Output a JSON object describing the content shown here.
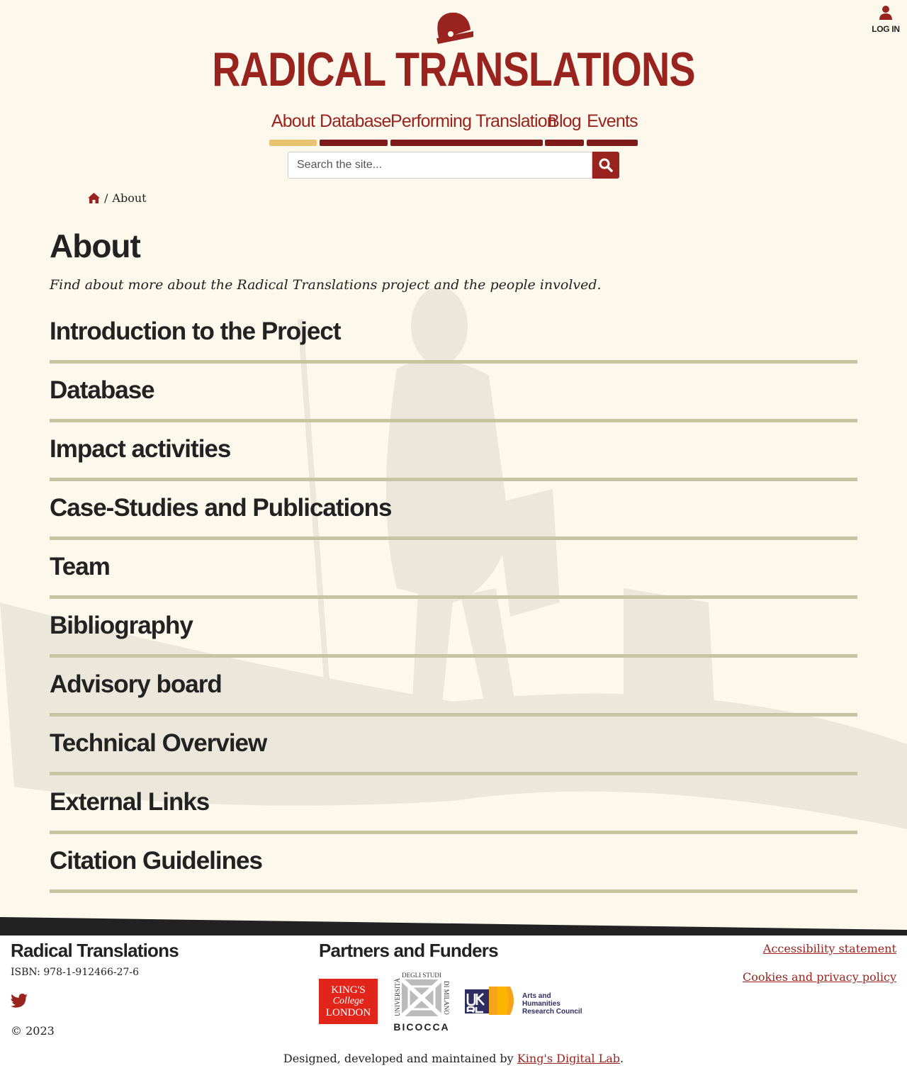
{
  "header": {
    "site_title": "RADICAL TRANSLATIONS",
    "login_label": "LOG IN",
    "brand_color": "#98231f",
    "active_color": "#e8c472"
  },
  "nav": {
    "items": [
      {
        "label": "About",
        "active": true
      },
      {
        "label": "Database",
        "active": false
      },
      {
        "label": "Performing Translation",
        "active": false
      },
      {
        "label": "Blog",
        "active": false
      },
      {
        "label": "Events",
        "active": false
      }
    ]
  },
  "search": {
    "placeholder": "Search the site..."
  },
  "breadcrumb": {
    "separator": "/",
    "current": "About"
  },
  "page": {
    "title": "About",
    "intro": "Find about more about the Radical Translations project and the people involved.",
    "sections": [
      "Introduction to the Project",
      "Database",
      "Impact activities",
      "Case-Studies and Publications",
      "Team",
      "Bibliography",
      "Advisory board",
      "Technical Overview",
      "External Links",
      "Citation Guidelines"
    ]
  },
  "footer": {
    "brand": "Radical Translations",
    "isbn": "ISBN: 978-1-912466-27-6",
    "copyright": "© 2023",
    "partners_title": "Partners and Funders",
    "partners": {
      "kcl_lines": [
        "KING'S",
        "College",
        "LONDON"
      ],
      "bicocca_top": "DEGLI STUDI",
      "bicocca_left": "UNIVERSITÀ",
      "bicocca_right": "DI MILANO",
      "bicocca_bottom": "BICOCCA",
      "ukri_lines": [
        "Arts and",
        "Humanities",
        "Research Council"
      ]
    },
    "links": [
      "Accessibility statement",
      "Cookies and privacy policy"
    ],
    "credits_prefix": "Designed, developed and maintained by",
    "credits_link": "King's Digital Lab",
    "credits_suffix": "."
  }
}
